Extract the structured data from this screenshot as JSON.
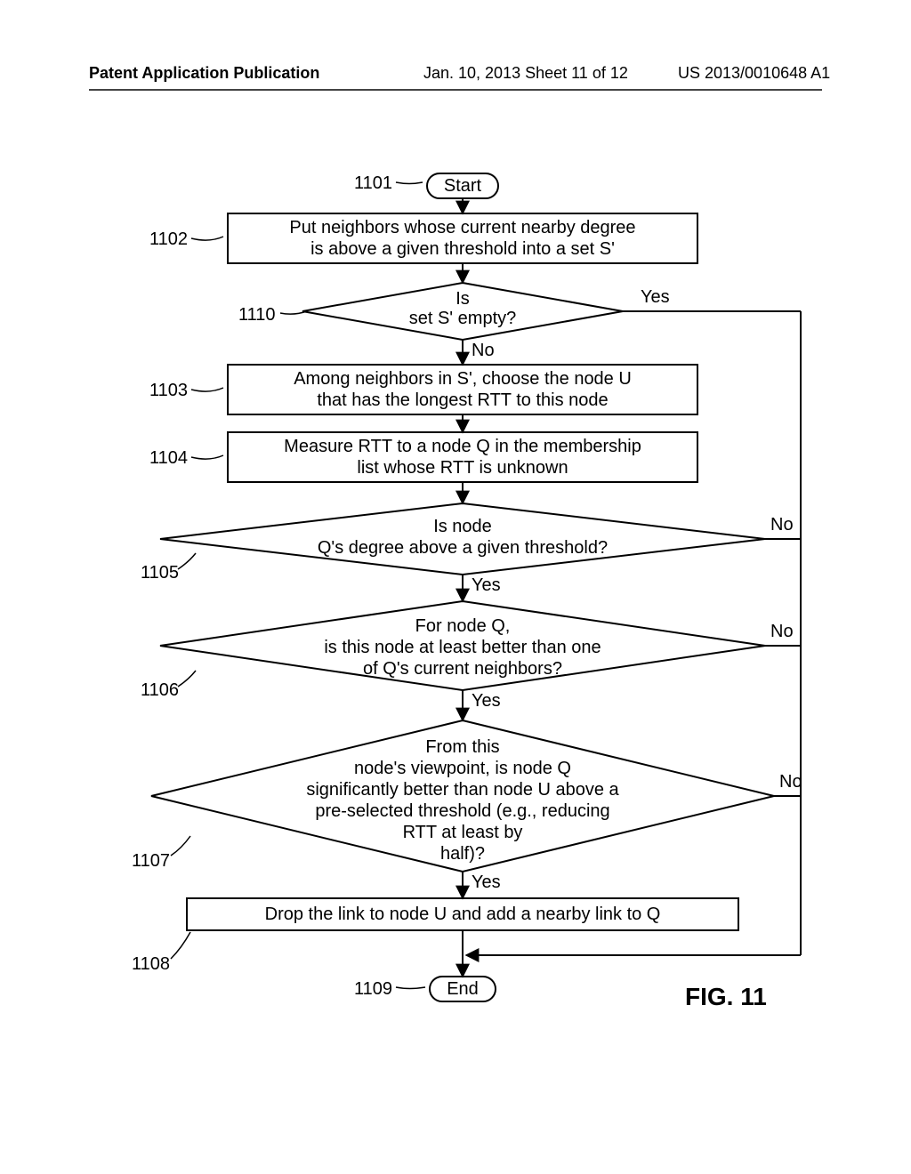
{
  "header": {
    "left": "Patent Application Publication",
    "mid": "Jan. 10, 2013  Sheet 11 of 12",
    "right": "US 2013/0010648 A1"
  },
  "figure_label": "FIG. 11",
  "refs": {
    "r1101": "1101",
    "r1102": "1102",
    "r1110": "1110",
    "r1103": "1103",
    "r1104": "1104",
    "r1105": "1105",
    "r1106": "1106",
    "r1107": "1107",
    "r1108": "1108",
    "r1109": "1109"
  },
  "nodes": {
    "start": "Start",
    "n1102_l1": "Put neighbors whose current nearby degree",
    "n1102_l2": "is above a given threshold into a set S'",
    "n1110_l1": "Is",
    "n1110_l2": "set S' empty?",
    "n1103_l1": "Among neighbors in S', choose the node U",
    "n1103_l2": "that has the longest RTT to this node",
    "n1104_l1": "Measure RTT to a node Q in the membership",
    "n1104_l2": "list whose RTT is unknown",
    "n1105_l1": "Is node",
    "n1105_l2": "Q's degree above a   given threshold?",
    "n1106_l1": "For node Q,",
    "n1106_l2": "is this node at least better than one",
    "n1106_l3": "of Q's current neighbors?",
    "n1107_l1": "From this",
    "n1107_l2": "node's viewpoint, is node Q",
    "n1107_l3": "significantly better than node U above a",
    "n1107_l4": "pre-selected threshold (e.g., reducing",
    "n1107_l5": "RTT at least by",
    "n1107_l6": "half)?",
    "n1108": "Drop the link to node U and add a nearby link to Q",
    "end": "End"
  },
  "edges": {
    "yes": "Yes",
    "no": "No"
  },
  "chart_data": {
    "type": "flowchart",
    "title": "FIG. 11",
    "nodes": [
      {
        "id": "1101",
        "type": "terminator",
        "text": "Start"
      },
      {
        "id": "1102",
        "type": "process",
        "text": "Put neighbors whose current nearby degree is above a given threshold into a set S'"
      },
      {
        "id": "1110",
        "type": "decision",
        "text": "Is set S' empty?"
      },
      {
        "id": "1103",
        "type": "process",
        "text": "Among neighbors in S', choose the node U that has the longest RTT to this node"
      },
      {
        "id": "1104",
        "type": "process",
        "text": "Measure RTT to a node Q in the membership list whose RTT is unknown"
      },
      {
        "id": "1105",
        "type": "decision",
        "text": "Is node Q's degree above a given threshold?"
      },
      {
        "id": "1106",
        "type": "decision",
        "text": "For node Q, is this node at least better than one of Q's current neighbors?"
      },
      {
        "id": "1107",
        "type": "decision",
        "text": "From this node's viewpoint, is node Q significantly better than node U above a pre-selected threshold (e.g., reducing RTT at least by half)?"
      },
      {
        "id": "1108",
        "type": "process",
        "text": "Drop the link to node U and add a nearby link to Q"
      },
      {
        "id": "1109",
        "type": "terminator",
        "text": "End"
      }
    ],
    "edges": [
      {
        "from": "1101",
        "to": "1102"
      },
      {
        "from": "1102",
        "to": "1110"
      },
      {
        "from": "1110",
        "to": "1103",
        "label": "No"
      },
      {
        "from": "1110",
        "to": "1109",
        "label": "Yes"
      },
      {
        "from": "1103",
        "to": "1104"
      },
      {
        "from": "1104",
        "to": "1105"
      },
      {
        "from": "1105",
        "to": "1106",
        "label": "Yes"
      },
      {
        "from": "1105",
        "to": "1109",
        "label": "No"
      },
      {
        "from": "1106",
        "to": "1107",
        "label": "Yes"
      },
      {
        "from": "1106",
        "to": "1109",
        "label": "No"
      },
      {
        "from": "1107",
        "to": "1108",
        "label": "Yes"
      },
      {
        "from": "1107",
        "to": "1109",
        "label": "No"
      },
      {
        "from": "1108",
        "to": "1109"
      }
    ]
  }
}
